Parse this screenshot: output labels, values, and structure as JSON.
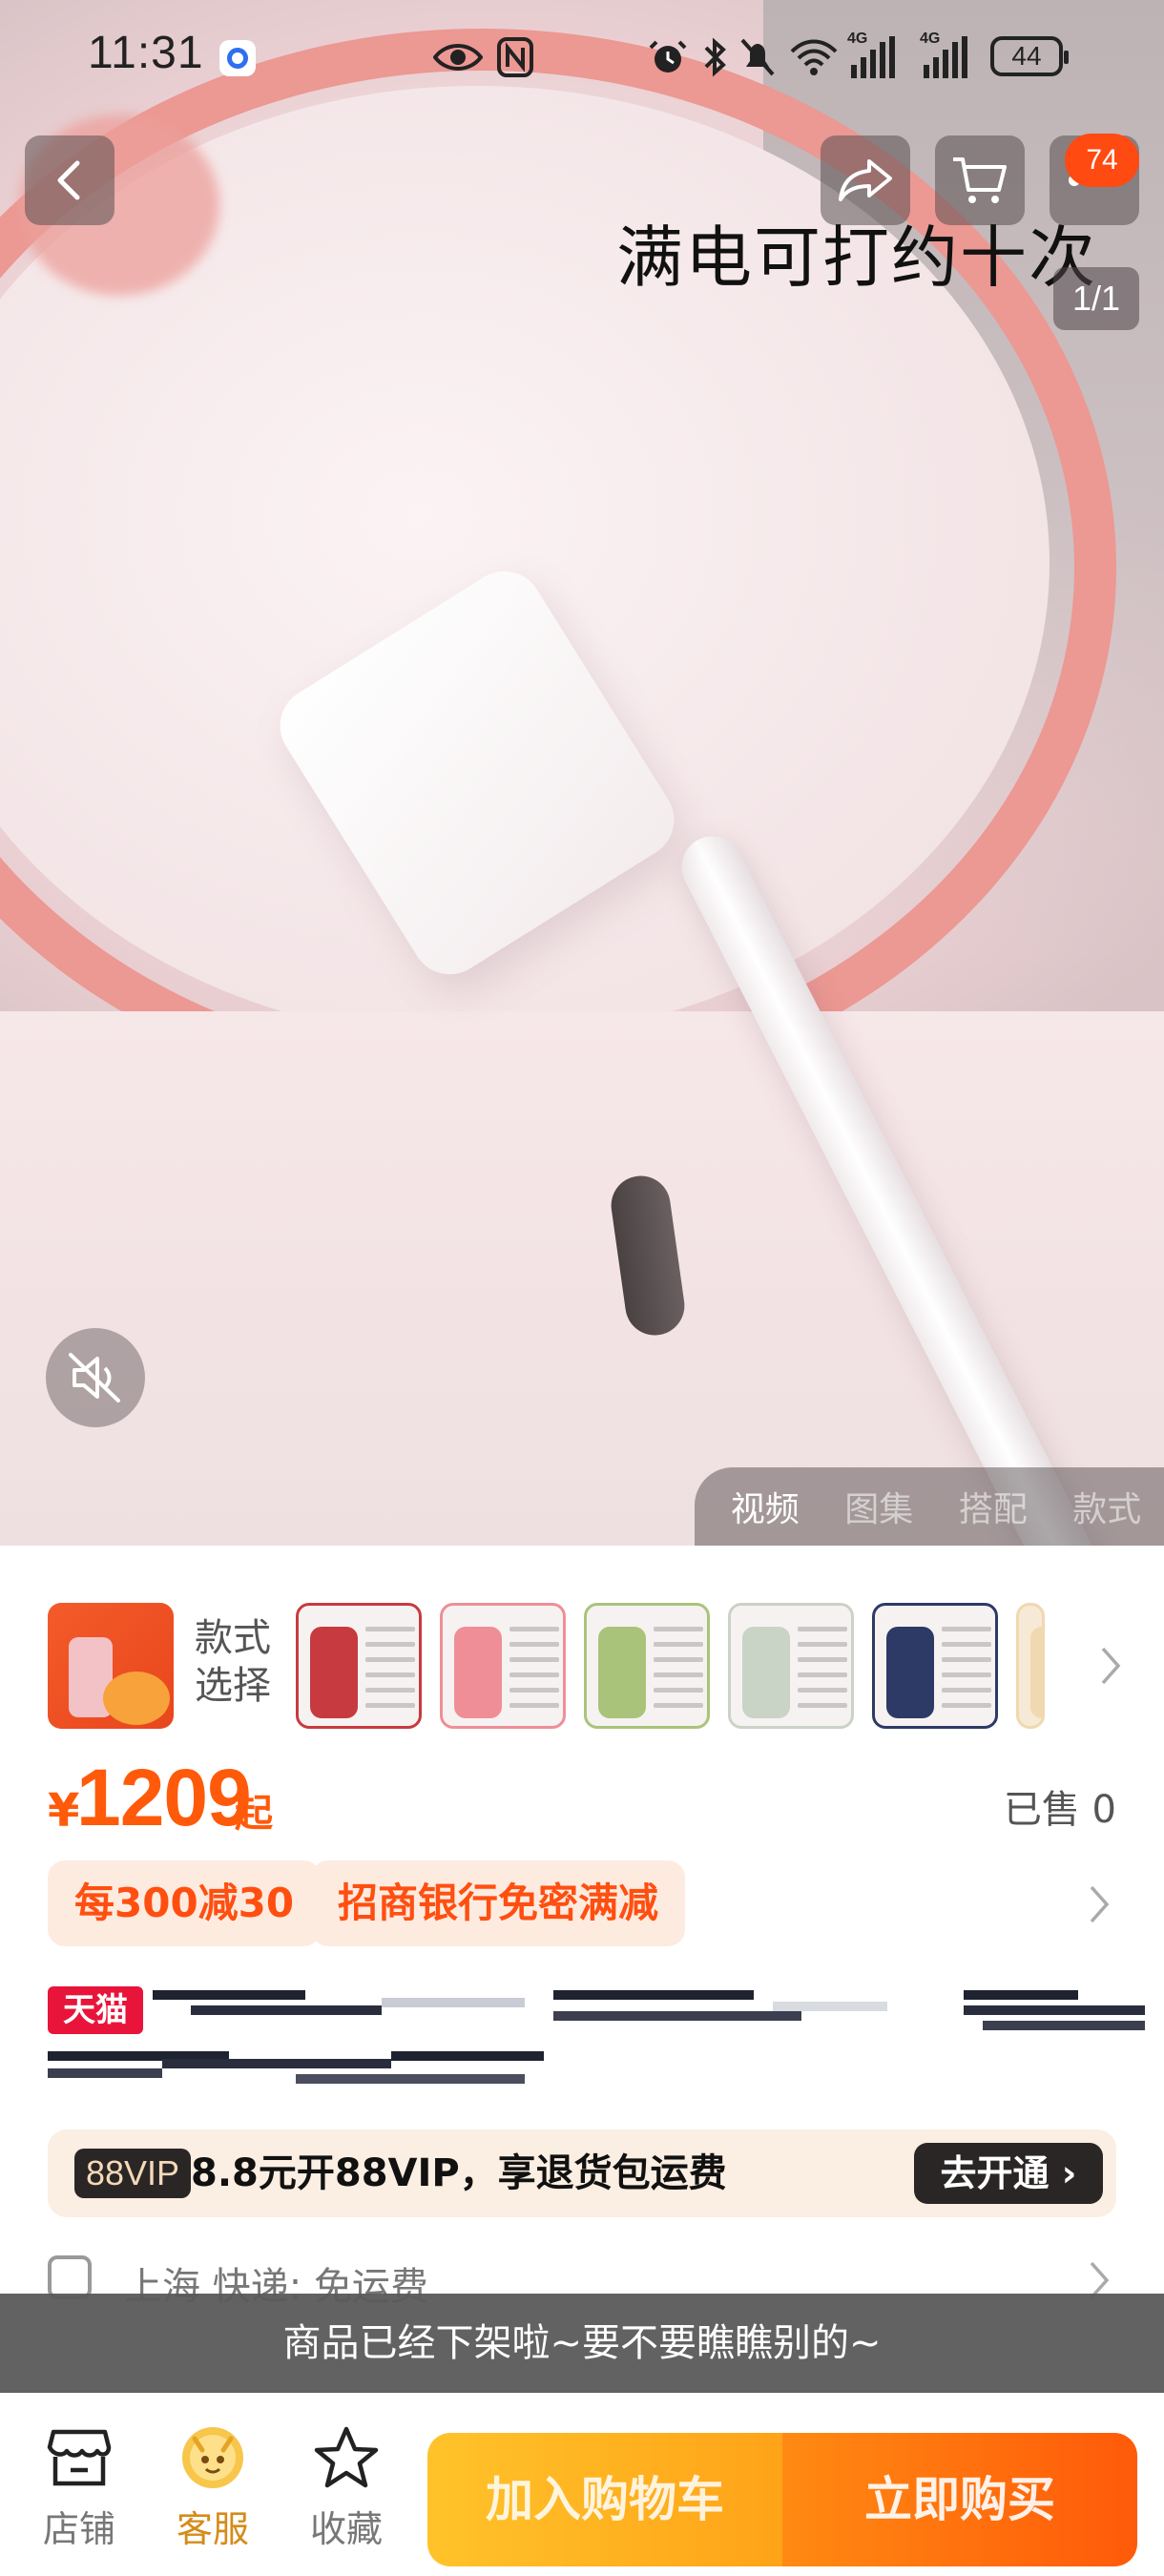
{
  "status_bar": {
    "time": "11:31",
    "battery": "44",
    "network_1": "4G",
    "network_2": "4G"
  },
  "header": {
    "cart_badge": "74",
    "caption": "满电可打约十次",
    "pager": "1/1"
  },
  "media_tabs": [
    {
      "label": "视频",
      "active": true
    },
    {
      "label": "图集",
      "active": false
    },
    {
      "label": "搭配",
      "active": false
    },
    {
      "label": "款式",
      "active": false
    }
  ],
  "style_selector": {
    "label_line1": "款式",
    "label_line2": "选择",
    "thumb_colors": [
      "#c73a3f",
      "#ef8e97",
      "#a9c47a",
      "#c9d3c6",
      "#2d3a66",
      "#f0d8b0"
    ]
  },
  "price": {
    "currency": "¥",
    "amount": "1209",
    "suffix": "起",
    "sold": "已售 0"
  },
  "promotions": [
    {
      "label": "每300减30"
    },
    {
      "label": "招商银行免密满减"
    }
  ],
  "title": {
    "tmall_badge": "天猫"
  },
  "vip": {
    "tag": "88VIP",
    "text": "8.8元开88VIP，享退货包运费",
    "button": "去开通 ›"
  },
  "shipping": {
    "text": "上海  快递: 免运费"
  },
  "toast": "商品已经下架啦~要不要瞧瞧别的~",
  "bottom_bar": {
    "shop": "店铺",
    "service": "客服",
    "favorite": "收藏",
    "add_to_cart": "加入购物车",
    "buy_now": "立即购买"
  },
  "colors": {
    "accent": "#ff5a0a",
    "cart_button": "#ffb21f",
    "buy_button": "#ff6a0e",
    "tmall": "#e8143a"
  },
  "icons": [
    "back-icon",
    "share-icon",
    "cart-icon",
    "more-icon",
    "mute-icon",
    "shop-icon",
    "service-icon",
    "star-icon",
    "chevron-right-icon",
    "truck-icon"
  ]
}
